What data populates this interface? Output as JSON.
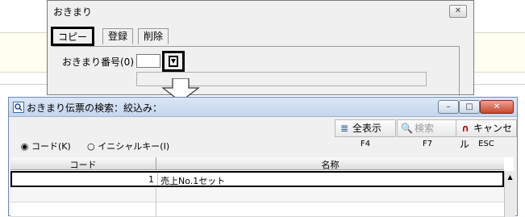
{
  "dialog": {
    "title": "おきまり",
    "close_glyph": "✕",
    "tabs": [
      "コピー",
      "登録",
      "削除"
    ],
    "field_label": "おきまり番号(0)",
    "picker_icon": "picker-down-icon"
  },
  "search_window": {
    "title": "おきまり伝票の検索：絞込み：",
    "min_glyph": "–",
    "max_glyph": "□",
    "close_glyph": "✕",
    "toolbar": [
      {
        "label": "全表示",
        "key": "F4",
        "icon": "list-icon",
        "glyph": "≣"
      },
      {
        "label": "検索",
        "key": "F7",
        "icon": "search-icon",
        "glyph": "🔍"
      },
      {
        "label": "キャンセル",
        "key": "ESC",
        "icon": "cancel-icon",
        "glyph": "∩"
      }
    ],
    "radio_options": [
      {
        "label": "コード(K)",
        "selected": true
      },
      {
        "label": "イニシャルキー(I)",
        "selected": false
      }
    ],
    "columns": [
      "コード",
      "名称"
    ],
    "rows": [
      {
        "code": "1",
        "name": "売上No.1セット"
      }
    ],
    "scroll_up_glyph": "▲"
  },
  "colors": {
    "accent_red": "#c00000",
    "title_blue": "#c4d6ee"
  }
}
